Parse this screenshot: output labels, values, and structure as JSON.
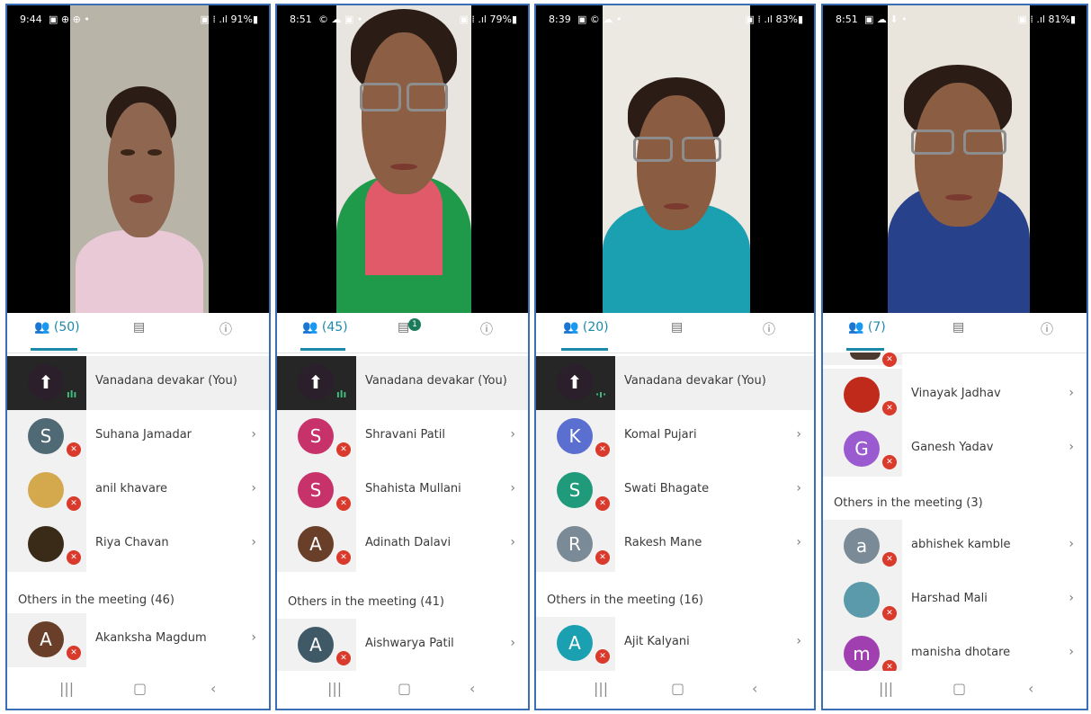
{
  "panels": [
    {
      "status": {
        "time": "9:44",
        "icons_left": "▣ ⊕ ⊕ •",
        "right": "▣ ⁞ .ıl 91%▮"
      },
      "tabs": {
        "people": "(50)",
        "chat_badge": ""
      },
      "rows": [
        {
          "name": "Vanadana devakar (You)",
          "initial": "",
          "kind": "me",
          "color": "#2a1f2a"
        },
        {
          "name": "Suhana Jamadar",
          "initial": "S",
          "kind": "letter",
          "color": "#4f6a75"
        },
        {
          "name": "anil khavare",
          "initial": "",
          "kind": "photo",
          "color": "#d4a84c"
        },
        {
          "name": "Riya Chavan",
          "initial": "",
          "kind": "photo",
          "color": "#3a2a18"
        }
      ],
      "section": "Others in the meeting (46)",
      "others": [
        {
          "name": "Akanksha Magdum",
          "initial": "A",
          "kind": "letter",
          "color": "#6a3f2a"
        }
      ]
    },
    {
      "status": {
        "time": "8:51",
        "icons_left": "© ☁ ▣ •",
        "right": "▣ ⁞ .ıl 79%▮"
      },
      "tabs": {
        "people": "(45)",
        "chat_badge": "1"
      },
      "rows": [
        {
          "name": "Vanadana devakar (You)",
          "initial": "",
          "kind": "me",
          "color": "#2a1f2a"
        },
        {
          "name": "Shravani Patil",
          "initial": "S",
          "kind": "letter",
          "color": "#c8326a"
        },
        {
          "name": "Shahista Mullani",
          "initial": "S",
          "kind": "letter",
          "color": "#c8326a"
        },
        {
          "name": "Adinath Dalavi",
          "initial": "A",
          "kind": "letter",
          "color": "#6a3f2a"
        }
      ],
      "section": "Others in the meeting (41)",
      "others": [
        {
          "name": "Aishwarya Patil",
          "initial": "A",
          "kind": "letter",
          "color": "#3f5a66"
        }
      ]
    },
    {
      "status": {
        "time": "8:39",
        "icons_left": "▣ © ☁ •",
        "right": "▣ ⁞ .ıl 83%▮"
      },
      "tabs": {
        "people": "(20)",
        "chat_badge": ""
      },
      "rows": [
        {
          "name": "Vanadana devakar (You)",
          "initial": "",
          "kind": "me",
          "color": "#2a1f2a"
        },
        {
          "name": "Komal Pujari",
          "initial": "K",
          "kind": "letter",
          "color": "#5a6fd0"
        },
        {
          "name": "Swati Bhagate",
          "initial": "S",
          "kind": "letter",
          "color": "#1f9a7a"
        },
        {
          "name": "Rakesh Mane",
          "initial": "R",
          "kind": "letter",
          "color": "#7a8a96"
        }
      ],
      "section": "Others in the meeting (16)",
      "others": [
        {
          "name": "Ajit Kalyani",
          "initial": "A",
          "kind": "letter",
          "color": "#1aa0b0"
        }
      ]
    },
    {
      "status": {
        "time": "8:51",
        "icons_left": "▣ ☁ ⬇ •",
        "right": "▣ ⁞ .ıl 81%▮"
      },
      "tabs": {
        "people": "(7)",
        "chat_badge": ""
      },
      "rows": [
        {
          "name": "Vinayak Jadhav",
          "initial": "",
          "kind": "photo",
          "color": "#c02a1a"
        },
        {
          "name": "Ganesh Yadav",
          "initial": "G",
          "kind": "letter",
          "color": "#9a5ad0"
        }
      ],
      "section": "Others in the meeting (3)",
      "others": [
        {
          "name": "abhishek kamble",
          "initial": "a",
          "kind": "letter",
          "color": "#7a8a96"
        },
        {
          "name": "Harshad Mali",
          "initial": "",
          "kind": "photo",
          "color": "#5a9aaa"
        },
        {
          "name": "manisha dhotare",
          "initial": "m",
          "kind": "letter",
          "color": "#a040b0"
        }
      ]
    }
  ],
  "navbar": {
    "recent": "|||",
    "home": "▢",
    "back": "‹"
  }
}
